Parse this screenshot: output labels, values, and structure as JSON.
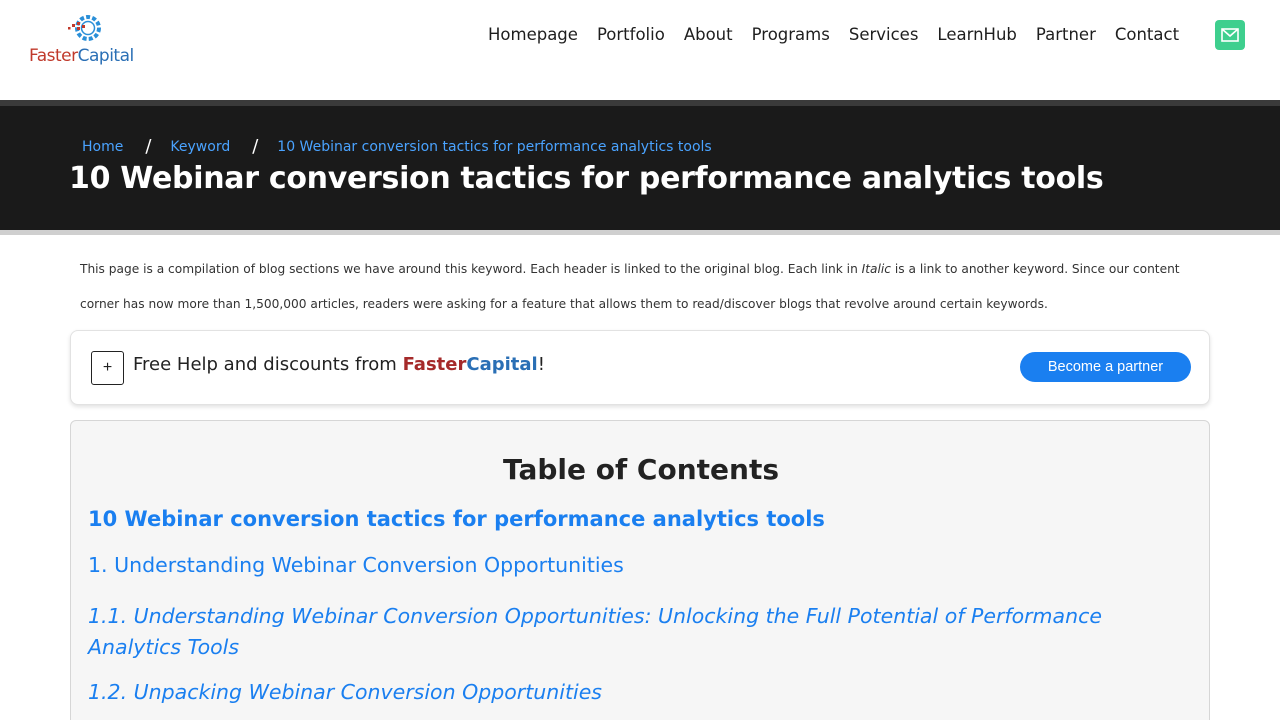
{
  "header": {
    "logo": {
      "faster": "Faster",
      "capital": "Capital"
    },
    "nav": [
      "Homepage",
      "Portfolio",
      "About",
      "Programs",
      "Services",
      "LearnHub",
      "Partner",
      "Contact"
    ],
    "mail_icon": "envelope-icon",
    "colors": {
      "mail_button": "#3ecf8e",
      "logo_red": "#c0392b",
      "logo_blue": "#2a6fb5"
    }
  },
  "banner": {
    "breadcrumb": [
      "Home",
      "Keyword",
      "10 Webinar conversion tactics for performance analytics tools"
    ],
    "separator": "/",
    "title": "10 Webinar conversion tactics for performance analytics tools"
  },
  "intro": {
    "before_italic": "This page is a compilation of blog sections we have around this keyword. Each header is linked to the original blog. Each link in ",
    "italic": "Italic",
    "after_italic": " is a link to another keyword. Since our content corner has now more than 1,500,000 articles, readers were asking for a feature that allows them to read/discover blogs that revolve around certain keywords."
  },
  "help": {
    "plus": "+",
    "text": "Free Help and discounts from ",
    "brand_faster": "Faster",
    "brand_capital": "Capital",
    "exclaim": "!",
    "button": "Become a partner"
  },
  "toc": {
    "title": "Table of Contents",
    "main": "10 Webinar conversion tactics for performance analytics tools",
    "items": [
      "1. Understanding Webinar Conversion Opportunities",
      "1.1. Understanding Webinar Conversion Opportunities: Unlocking the Full Potential of Performance Analytics Tools",
      "1.2. Unpacking Webinar Conversion Opportunities"
    ]
  }
}
